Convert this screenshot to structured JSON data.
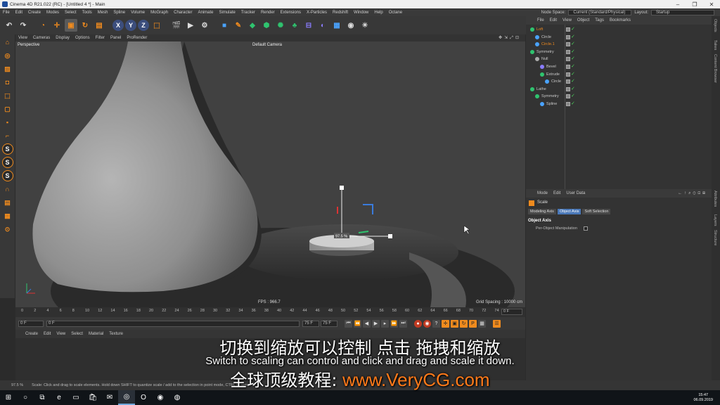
{
  "window": {
    "title": "Cinema 4D R21.022 (RC) - [Untitled 4 *] - Main",
    "controls": [
      "–",
      "❐",
      "✕"
    ]
  },
  "menubar": {
    "items": [
      "File",
      "Edit",
      "Create",
      "Modes",
      "Select",
      "Tools",
      "Mesh",
      "Spline",
      "Volume",
      "MoGraph",
      "Character",
      "Animate",
      "Simulate",
      "Tracker",
      "Render",
      "Extensions",
      "X-Particles",
      "Redshift",
      "Window",
      "Help",
      "Octane"
    ],
    "node_space_label": "Node Space:",
    "node_space_value": "Current (Standard/Physical)",
    "layout_label": "Layout:",
    "layout_value": "Startup"
  },
  "axis_buttons": [
    "X",
    "Y",
    "Z"
  ],
  "viewport": {
    "menu": [
      "View",
      "Cameras",
      "Display",
      "Options",
      "Filter",
      "Panel",
      "ProRender"
    ],
    "view_name": "Perspective",
    "camera": "Default Camera",
    "fps": "FPS : 966.7",
    "grid_spacing": "Grid Spacing : 10000 cm",
    "scale_readout": "97.5 %"
  },
  "timeline": {
    "ticks": [
      "0",
      "2",
      "4",
      "6",
      "8",
      "10",
      "12",
      "14",
      "16",
      "18",
      "20",
      "22",
      "24",
      "26",
      "28",
      "30",
      "32",
      "34",
      "36",
      "38",
      "40",
      "42",
      "44",
      "46",
      "48",
      "50",
      "52",
      "54",
      "56",
      "58",
      "60",
      "62",
      "64",
      "66",
      "68",
      "70",
      "72",
      "74"
    ],
    "current_frame": "0 F"
  },
  "transport": {
    "start": "0 F",
    "min": "0 F",
    "max": "75 F",
    "end": "75 F"
  },
  "material_manager": {
    "menu": [
      "Create",
      "Edit",
      "View",
      "Select",
      "Material",
      "Texture"
    ]
  },
  "object_manager": {
    "menu": [
      "File",
      "Edit",
      "View",
      "Object",
      "Tags",
      "Bookmarks"
    ],
    "objects": [
      {
        "name": "Loft",
        "indent": 0,
        "color": "#f08b1e",
        "icon_color": "#2fc46f"
      },
      {
        "name": "Circle",
        "indent": 1,
        "color": "#c8c8c8",
        "icon_color": "#4aa3ff"
      },
      {
        "name": "Circle.1",
        "indent": 1,
        "color": "#f08b1e",
        "icon_color": "#4aa3ff"
      },
      {
        "name": "Symmetry",
        "indent": 0,
        "color": "#c8c8c8",
        "icon_color": "#2fc46f"
      },
      {
        "name": "Null",
        "indent": 1,
        "color": "#c8c8c8",
        "icon_color": "#aaaaaa"
      },
      {
        "name": "Bevel",
        "indent": 2,
        "color": "#c8c8c8",
        "icon_color": "#8a7cff"
      },
      {
        "name": "Extrude",
        "indent": 2,
        "color": "#c8c8c8",
        "icon_color": "#2fc46f"
      },
      {
        "name": "Circle",
        "indent": 3,
        "color": "#c8c8c8",
        "icon_color": "#4aa3ff"
      },
      {
        "name": "Lathe",
        "indent": 0,
        "color": "#c8c8c8",
        "icon_color": "#2fc46f"
      },
      {
        "name": "Symmetry",
        "indent": 1,
        "color": "#c8c8c8",
        "icon_color": "#2fc46f"
      },
      {
        "name": "Spline",
        "indent": 2,
        "color": "#c8c8c8",
        "icon_color": "#4aa3ff"
      }
    ]
  },
  "attribute_manager": {
    "menu": [
      "Mode",
      "Edit",
      "User Data"
    ],
    "tool_name": "Scale",
    "tabs": [
      "Modeling Axis",
      "Object Axis",
      "Soft Selection"
    ],
    "active_tab": "Object Axis",
    "section": "Object Axis",
    "field_label": "Per-Object Manipulation"
  },
  "right_tabs": [
    "Objects",
    "Takes",
    "Content Browser",
    "Attributes",
    "Layers",
    "Structure"
  ],
  "statusbar": {
    "zoom": "97.5 %",
    "message": "Scale: Click and drag to scale elements. Hold down SHIFT to quantize scale / add to the selection in point mode, CTRL to remove."
  },
  "subtitles": {
    "chinese": "切换到缩放可以控制 点击 拖拽和缩放",
    "english": "Switch to scaling can control and click and drag and scale it down.",
    "brand_prefix": "全球顶级教程:",
    "brand_url": "www.VeryCG.com"
  },
  "taskbar": {
    "time": "15:47",
    "date": "06.09.2019"
  },
  "colors": {
    "accent_orange": "#f08b1e",
    "active_tab_blue": "#4a78b8",
    "check_green": "#4cd05b",
    "brand_orange": "#ff7a1a"
  }
}
